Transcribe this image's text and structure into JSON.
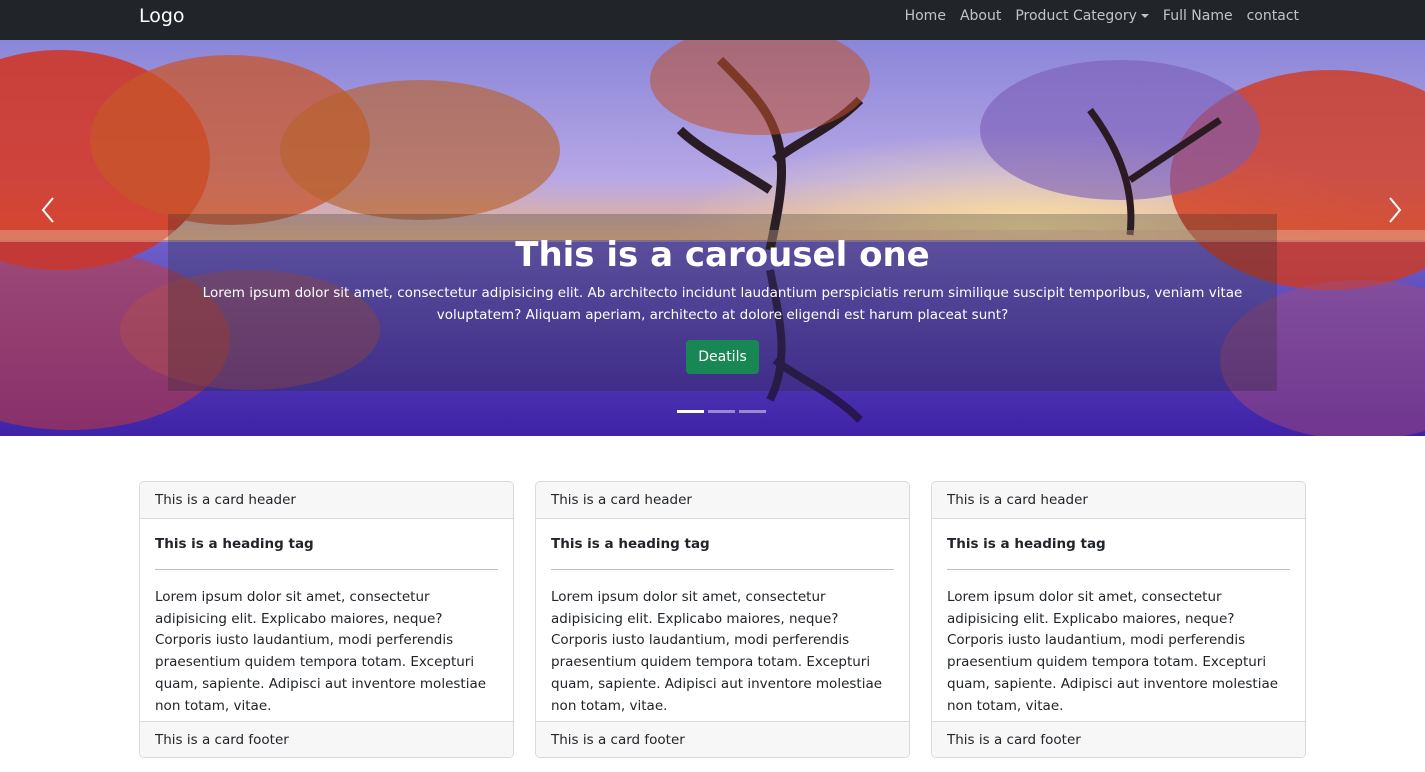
{
  "navbar": {
    "brand": "Logo",
    "links": [
      "Home",
      "About",
      "Product Category",
      "Full Name",
      "contact"
    ]
  },
  "carousel": {
    "title": "This is a carousel one",
    "text": "Lorem ipsum dolor sit amet, consectetur adipisicing elit. Ab architecto incidunt laudantium perspiciatis rerum similique suscipit temporibus, veniam vitae voluptatem? Aliquam aperiam, architecto at dolore eligendi est harum placeat sunt?",
    "button_label": "Deatils",
    "slide_count": 3,
    "active_index": 0
  },
  "cards": [
    {
      "header": "This is a card header",
      "title": "This is a heading tag",
      "text": "Lorem ipsum dolor sit amet, consectetur adipisicing elit. Explicabo maiores, neque? Corporis iusto laudantium, modi perferendis praesentium quidem tempora totam. Excepturi quam, sapiente. Adipisci aut inventore molestiae non totam, vitae.",
      "footer": "This is a card footer"
    },
    {
      "header": "This is a card header",
      "title": "This is a heading tag",
      "text": "Lorem ipsum dolor sit amet, consectetur adipisicing elit. Explicabo maiores, neque? Corporis iusto laudantium, modi perferendis praesentium quidem tempora totam. Excepturi quam, sapiente. Adipisci aut inventore molestiae non totam, vitae.",
      "footer": "This is a card footer"
    },
    {
      "header": "This is a card header",
      "title": "This is a heading tag",
      "text": "Lorem ipsum dolor sit amet, consectetur adipisicing elit. Explicabo maiores, neque? Corporis iusto laudantium, modi perferendis praesentium quidem tempora totam. Excepturi quam, sapiente. Adipisci aut inventore molestiae non totam, vitae.",
      "footer": "This is a card footer"
    }
  ],
  "colors": {
    "navbar_bg": "#212529",
    "button_green": "#198754"
  }
}
